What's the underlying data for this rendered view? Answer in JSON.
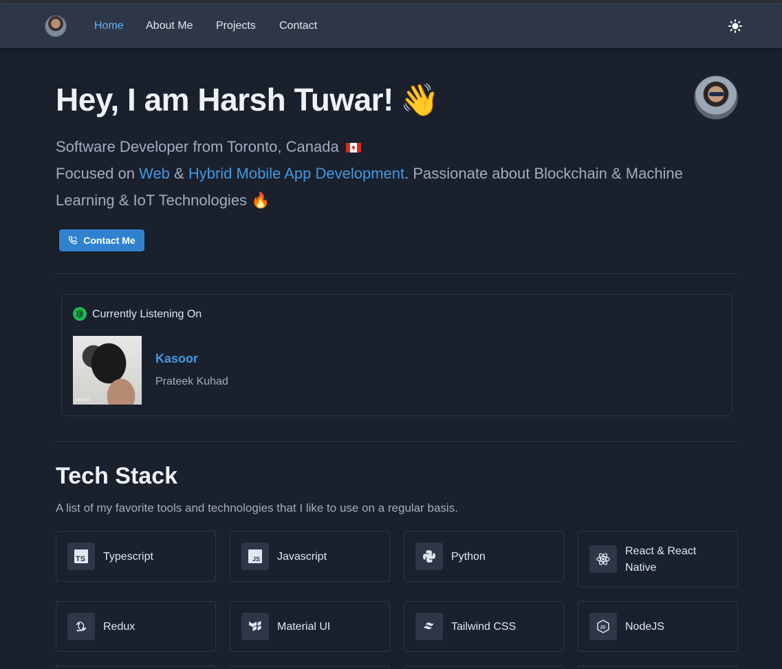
{
  "nav": {
    "links": [
      "Home",
      "About Me",
      "Projects",
      "Contact"
    ],
    "active": "Home",
    "accent_color": "#63b3ed",
    "theme_icon": "sun-icon"
  },
  "hero": {
    "title": "Hey, I am Harsh Tuwar!",
    "wave_emoji": "👋",
    "line1": "Software Developer from Toronto, Canada",
    "line2_prefix": "Focused on ",
    "web": "Web",
    "amp": " & ",
    "hybrid": "Hybrid Mobile App Development",
    "line2_suffix": ". Passionate about Blockchain & Machine",
    "line3": "Learning & IoT Technologies",
    "fire_emoji": "🔥",
    "contact_button": "Contact Me"
  },
  "listening": {
    "label": "Currently Listening On",
    "song": "Kasoor",
    "artist": "Prateek Kuhad",
    "album_art_caption": "KASOOR",
    "spotify_color": "#1db954"
  },
  "tech_stack": {
    "title": "Tech Stack",
    "subtitle": "A list of my favorite tools and technologies that I like to use on a regular basis.",
    "items": [
      {
        "label": "Typescript",
        "icon": "typescript-icon"
      },
      {
        "label": "Javascript",
        "icon": "javascript-icon"
      },
      {
        "label": "Python",
        "icon": "python-icon"
      },
      {
        "label": "React & React Native",
        "icon": "react-icon"
      },
      {
        "label": "Redux",
        "icon": "redux-icon"
      },
      {
        "label": "Material UI",
        "icon": "material-ui-icon"
      },
      {
        "label": "Tailwind CSS",
        "icon": "tailwind-icon"
      },
      {
        "label": "NodeJS",
        "icon": "nodejs-icon"
      }
    ]
  }
}
